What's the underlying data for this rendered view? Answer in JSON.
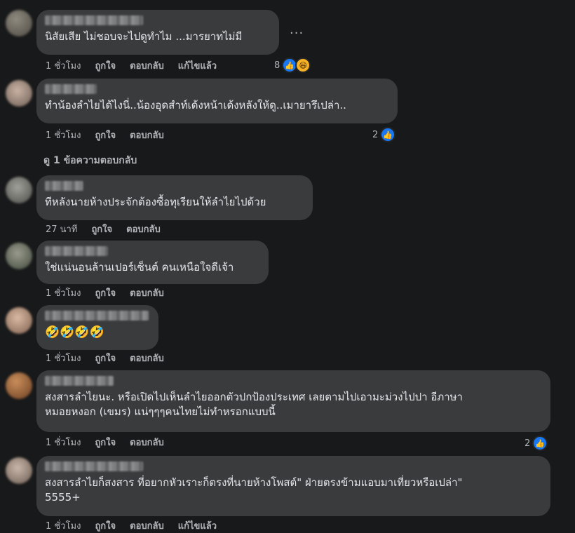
{
  "comments": [
    {
      "text": "นิสัยเสีย ไม่ชอบจะไปดูทำไม ...มารยาทไม่มี",
      "time": "1 ชั่วโมง",
      "like": "ถูกใจ",
      "reply": "ตอบกลับ",
      "edited": "แก้ไขแล้ว",
      "react_count": "8",
      "react_icons": [
        "like-icon",
        "haha-icon"
      ],
      "more": "..."
    },
    {
      "text": "ทำน้องลำไยได้ไงนี่..น้องอุดสำท์เด้งหน้าเด้งหลังให้ดู..เมายารึเปล่า..",
      "time": "1 ชั่วโมง",
      "like": "ถูกใจ",
      "reply": "ตอบกลับ",
      "react_count": "2",
      "react_icons": [
        "like-icon"
      ]
    },
    {
      "text": "ทีหลังนายห้างประจักต้องซื้อทุเรียนให้ลำไยไปด้วย",
      "time": "27 นาที",
      "like": "ถูกใจ",
      "reply": "ตอบกลับ"
    },
    {
      "text": "ใช่แน่นอนล้านเปอร์เซ็นต์ คนเหนือใจดีเจ้า",
      "time": "1 ชั่วโมง",
      "like": "ถูกใจ",
      "reply": "ตอบกลับ"
    },
    {
      "text": "🤣🤣🤣🤣",
      "time": "1 ชั่วโมง",
      "like": "ถูกใจ",
      "reply": "ตอบกลับ"
    },
    {
      "text": "สงสารลำไยนะ. หรือเปิดไปเห็นลำไยออกตัวปกป้องประเทศ เลยตามไปเอามะม่วงไปปา อีภาษา\nหมอยหงอก (เขมร) แน่ๆๆๆคนไทยไม่ทำหรอกแบบนี้",
      "time": "1 ชั่วโมง",
      "like": "ถูกใจ",
      "reply": "ตอบกลับ",
      "react_count": "2",
      "react_icons": [
        "like-icon"
      ]
    },
    {
      "text": "สงสารลำไยก็สงสาร ที่อยากหัวเราะก็ตรงที่นายห้างโพสต์\" ฝ่ายตรงข้ามแอบมาเที่ยวหรือเปล่า\"\n5555+",
      "time": "1 ชั่วโมง",
      "like": "ถูกใจ",
      "reply": "ตอบกลับ",
      "edited": "แก้ไขแล้ว"
    }
  ],
  "view_replies": "ดู 1 ข้อความตอบกลับ",
  "colors": {
    "background": "#18191a",
    "bubble": "#3a3b3c",
    "text": "#e4e6eb",
    "meta": "#b0b3b8",
    "like_blue": "#1877f2",
    "haha_yellow": "#f7b125"
  }
}
